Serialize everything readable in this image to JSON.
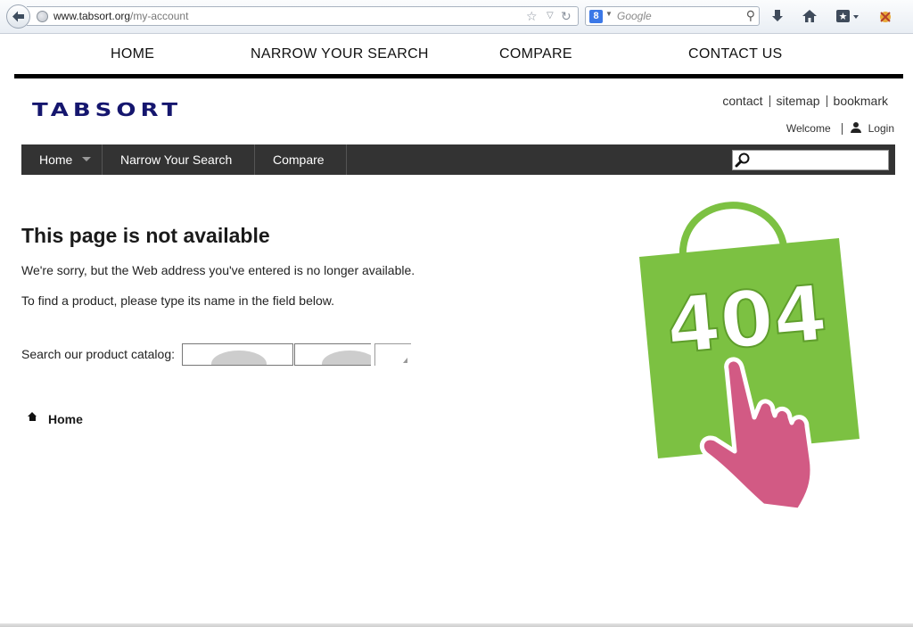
{
  "browser": {
    "url_domain": "www.tabsort.org",
    "url_path": "/my-account",
    "search_placeholder": "Google",
    "search_engine_badge": "8"
  },
  "top_nav": [
    {
      "label": "HOME"
    },
    {
      "label": "NARROW YOUR SEARCH"
    },
    {
      "label": "COMPARE"
    },
    {
      "label": "CONTACT US"
    }
  ],
  "header": {
    "logo_text": "TABSORT",
    "links": [
      "contact",
      "sitemap",
      "bookmark"
    ],
    "welcome": "Welcome",
    "login": "Login"
  },
  "menu": {
    "items": [
      {
        "label": "Home"
      },
      {
        "label": "Narrow Your Search"
      },
      {
        "label": "Compare"
      }
    ]
  },
  "content": {
    "title": "This page is not available",
    "sorry": "We're sorry, but the Web address you've entered is no longer available.",
    "find": "To find a product, please type its name in the field below.",
    "catalog_label": "Search our product catalog:",
    "home_link": "Home"
  },
  "illustration": {
    "code_text": "404"
  },
  "colors": {
    "logo": "#15166e",
    "menu_bar": "#333333",
    "bag_green": "#7cc142",
    "hand_pink": "#d25a84"
  }
}
